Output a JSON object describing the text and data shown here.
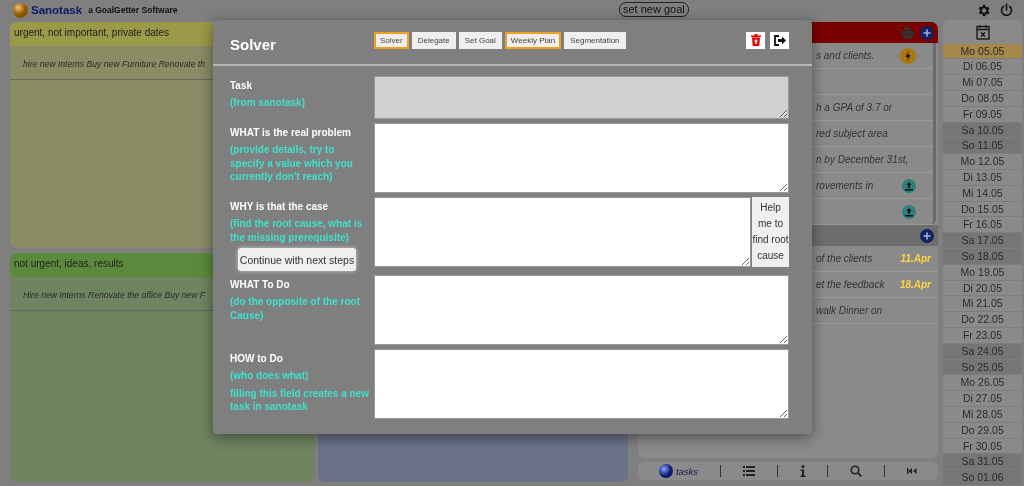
{
  "header": {
    "app_name": "Sanotask",
    "tagline": "a GoalGetter Software",
    "goal_button": "set new goal"
  },
  "quadrants": [
    {
      "title": "urgent, not important, private dates",
      "color": "#9a9a48",
      "tasks": [
        "hire new Interns Buy new Furniture Renovate th"
      ]
    },
    {
      "title": "not urgent, ideas, results",
      "color": "#5b8a3c",
      "tasks": [
        "Hire new Interns Renovate the office Buy new F"
      ]
    },
    {
      "color": "#6b7187"
    }
  ],
  "task_panels": [
    {
      "color": "#7a0000",
      "rows": [
        {
          "kind": "flash",
          "text": "s and clients."
        },
        {
          "kind": "plain"
        },
        {
          "kind": "plain",
          "text": "h a GPA of 3.7 or"
        },
        {
          "kind": "plain",
          "text": "red subject area"
        },
        {
          "kind": "plain",
          "text": "n by December 31st,"
        },
        {
          "kind": "upload",
          "text": "rovements in"
        },
        {
          "kind": "upload"
        }
      ]
    },
    {
      "color": "#6e6e6e",
      "rows": [
        {
          "text": "of the clients",
          "date": "11.Apr"
        },
        {
          "text": "et the feedback",
          "date": "18.Apr"
        },
        {
          "text": "walk Dinner on"
        }
      ]
    }
  ],
  "toolbar": {
    "label": "tasks"
  },
  "calendar": {
    "days": [
      {
        "label": "Mo 05.05",
        "selected": true,
        "weekend": false
      },
      {
        "label": "Di 06.05",
        "selected": false,
        "weekend": false
      },
      {
        "label": "Mi 07.05",
        "selected": false,
        "weekend": false
      },
      {
        "label": "Do 08.05",
        "selected": false,
        "weekend": false
      },
      {
        "label": "Fr 09.05",
        "selected": false,
        "weekend": false
      },
      {
        "label": "Sa 10.05",
        "selected": false,
        "weekend": true
      },
      {
        "label": "So 11.05",
        "selected": false,
        "weekend": true
      },
      {
        "label": "Mo 12.05",
        "selected": false,
        "weekend": false
      },
      {
        "label": "Di 13.05",
        "selected": false,
        "weekend": false
      },
      {
        "label": "Mi 14.05",
        "selected": false,
        "weekend": false
      },
      {
        "label": "Do 15.05",
        "selected": false,
        "weekend": false
      },
      {
        "label": "Fr 16.05",
        "selected": false,
        "weekend": false
      },
      {
        "label": "Sa 17.05",
        "selected": false,
        "weekend": true
      },
      {
        "label": "So 18.05",
        "selected": false,
        "weekend": true
      },
      {
        "label": "Mo 19.05",
        "selected": false,
        "weekend": false
      },
      {
        "label": "Di 20.05",
        "selected": false,
        "weekend": false
      },
      {
        "label": "Mi 21.05",
        "selected": false,
        "weekend": false
      },
      {
        "label": "Do 22.05",
        "selected": false,
        "weekend": false
      },
      {
        "label": "Fr 23.05",
        "selected": false,
        "weekend": false
      },
      {
        "label": "Sa 24.05",
        "selected": false,
        "weekend": true
      },
      {
        "label": "So 25.05",
        "selected": false,
        "weekend": true
      },
      {
        "label": "Mo 26.05",
        "selected": false,
        "weekend": false
      },
      {
        "label": "Di 27.05",
        "selected": false,
        "weekend": false
      },
      {
        "label": "Mi 28.05",
        "selected": false,
        "weekend": false
      },
      {
        "label": "Do 29.05",
        "selected": false,
        "weekend": false
      },
      {
        "label": "Fr 30.05",
        "selected": false,
        "weekend": false
      },
      {
        "label": "Sa 31.05",
        "selected": false,
        "weekend": true
      },
      {
        "label": "So 01.06",
        "selected": false,
        "weekend": true
      }
    ]
  },
  "dialog": {
    "title": "Solver",
    "tabs": [
      {
        "label": "Solver",
        "highlighted": true
      },
      {
        "label": "Delegate",
        "highlighted": false
      },
      {
        "label": "Set Goal",
        "highlighted": false
      },
      {
        "label": "Weekly Plan",
        "highlighted": true
      },
      {
        "label": "Segmentation",
        "highlighted": false
      }
    ],
    "fields": [
      {
        "label": "Task",
        "hints": [
          "(from sanotask)"
        ],
        "disabled": true
      },
      {
        "label": "WHAT is the real problem",
        "hints": [
          "(provide details, try to specify a value which you currently don't reach)"
        ],
        "disabled": false
      },
      {
        "label": "WHY is that the case",
        "hints": [
          "(find the root cause, what is the missing prerequisite)"
        ],
        "disabled": false,
        "action_button": "Continue with next steps",
        "help_button": "Help me to find root cause"
      },
      {
        "label": "WHAT To Do",
        "hints": [
          "(do the opposite of the root Cause)"
        ],
        "disabled": false
      },
      {
        "label": "HOW to Do",
        "hints": [
          "(who does what)",
          "filling this field creates a new task in sanotask"
        ],
        "disabled": false
      }
    ]
  }
}
